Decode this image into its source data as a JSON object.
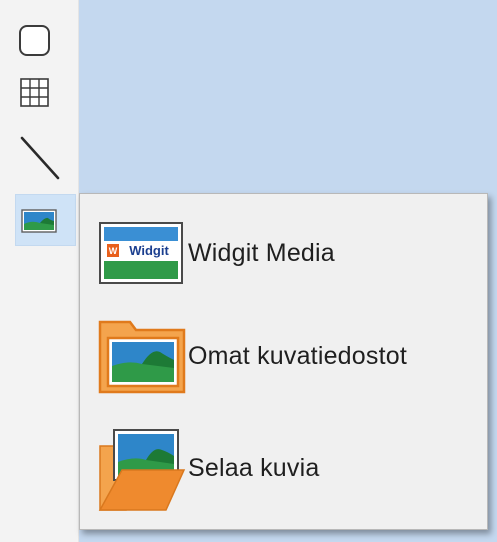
{
  "toolbar": {
    "tools": [
      {
        "name": "rounded-rectangle-tool",
        "icon": "rounded-square-icon"
      },
      {
        "name": "table-tool",
        "icon": "grid-icon"
      },
      {
        "name": "line-tool",
        "icon": "line-icon"
      },
      {
        "name": "image-tool",
        "icon": "image-icon",
        "active": true
      }
    ]
  },
  "image_menu": {
    "items": [
      {
        "label": "Widgit Media",
        "icon": "widgit-media-icon",
        "icon_text": "Widgit"
      },
      {
        "label": "Omat kuvatiedostot",
        "icon": "folder-image-icon"
      },
      {
        "label": "Selaa kuvia",
        "icon": "open-folder-image-icon"
      }
    ]
  },
  "colors": {
    "canvas_bg": "#c4d8ef",
    "toolbar_bg": "#f3f3f3",
    "active_tool_bg": "#cfe3f7",
    "popup_bg": "#f0f0f0",
    "folder_orange": "#f08a28",
    "folder_fill": "#f4a44d",
    "widgit_orange": "#e8601c"
  }
}
